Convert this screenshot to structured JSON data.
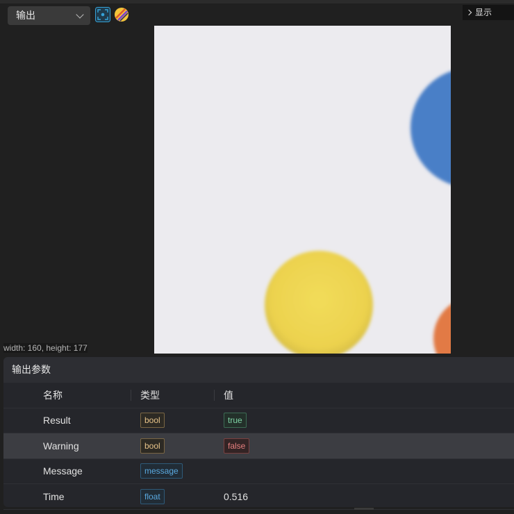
{
  "toolbar": {
    "dropdown_value": "输出",
    "show_label": "显示"
  },
  "image": {
    "size_label": "width: 160, height: 177"
  },
  "params": {
    "title": "输出参数",
    "headers": {
      "name": "名称",
      "type": "类型",
      "value": "值"
    },
    "rows": [
      {
        "name": "Result",
        "type": "bool",
        "value": "true"
      },
      {
        "name": "Warning",
        "type": "bool",
        "value": "false"
      },
      {
        "name": "Message",
        "type": "message",
        "value": ""
      },
      {
        "name": "Time",
        "type": "float",
        "value": "0.516"
      }
    ]
  },
  "colors": {
    "bool": "#e8c48a",
    "true": "#7fd3a5",
    "false": "#e77f7f",
    "message": "#5aa9e0"
  }
}
